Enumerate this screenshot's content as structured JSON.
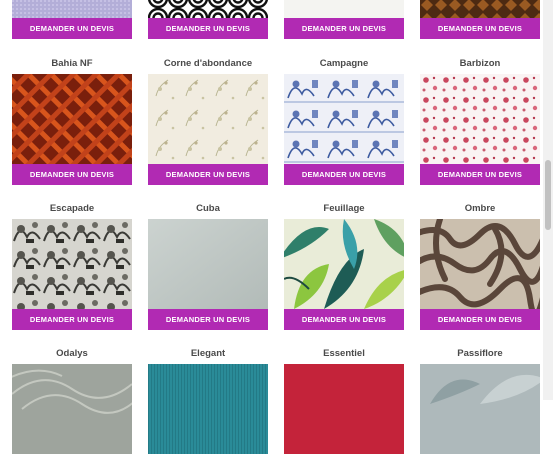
{
  "cta_label": "DEMANDER UN DEVIS",
  "colors": {
    "cta_background": "#b12ab3",
    "cta_text": "#ffffff",
    "name_text": "#4a4a4a"
  },
  "rows": [
    {
      "products": [
        {
          "name": "",
          "pattern": "lilac-fabric"
        },
        {
          "name": "",
          "pattern": "black-white-circles"
        },
        {
          "name": "",
          "pattern": "off-white-plain"
        },
        {
          "name": "",
          "pattern": "brown-geometric"
        }
      ]
    },
    {
      "products": [
        {
          "name": "Bahia NF",
          "pattern": "red-orange-lattice"
        },
        {
          "name": "Corne d'abondance",
          "pattern": "cream-sprigs"
        },
        {
          "name": "Campagne",
          "pattern": "blue-toile"
        },
        {
          "name": "Barbizon",
          "pattern": "pink-floral"
        }
      ]
    },
    {
      "products": [
        {
          "name": "Escapade",
          "pattern": "grey-toile"
        },
        {
          "name": "Cuba",
          "pattern": "pale-grey-plain"
        },
        {
          "name": "Feuillage",
          "pattern": "tropical-leaves"
        },
        {
          "name": "Ombre",
          "pattern": "brown-maze"
        }
      ]
    },
    {
      "products": [
        {
          "name": "Odalys",
          "pattern": "sage-leaves"
        },
        {
          "name": "Elegant",
          "pattern": "teal-weave"
        },
        {
          "name": "Essentiel",
          "pattern": "red-plain"
        },
        {
          "name": "Passiflore",
          "pattern": "blue-grey-leaves"
        }
      ]
    }
  ]
}
